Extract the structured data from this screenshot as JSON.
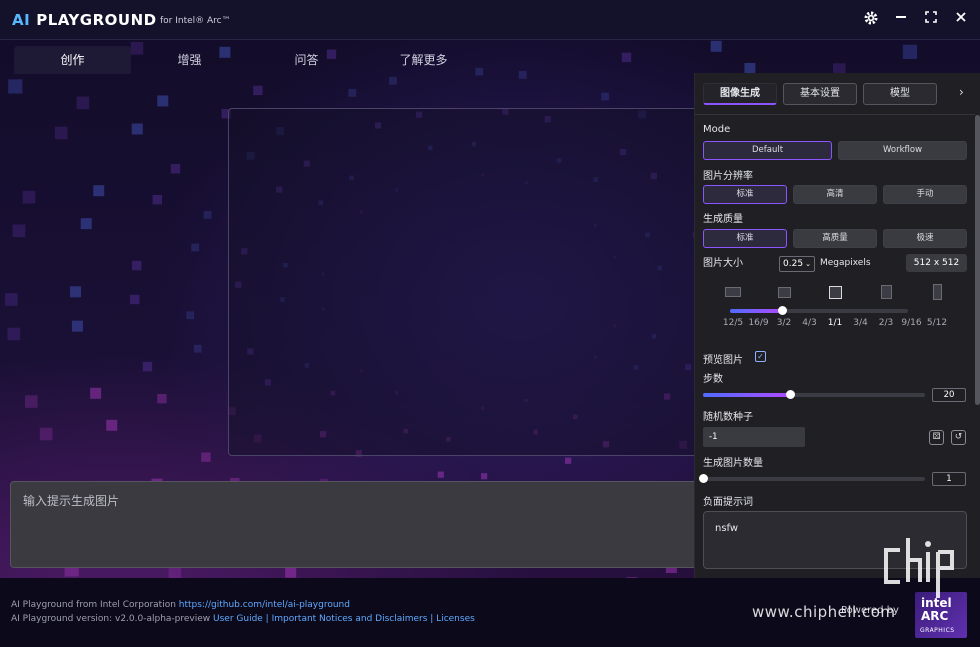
{
  "titlebar": {
    "brand_ai": "AI",
    "brand_name": "PLAYGROUND",
    "brand_sub": "for Intel® Arc™",
    "icons": [
      "gear-icon",
      "minimize-icon",
      "maximize-icon",
      "close-icon"
    ]
  },
  "main_tabs": [
    {
      "label": "创作",
      "active": true
    },
    {
      "label": "增强",
      "active": false
    },
    {
      "label": "问答",
      "active": false
    },
    {
      "label": "了解更多",
      "active": false
    }
  ],
  "prompt": {
    "placeholder": "输入提示生成图片"
  },
  "panel": {
    "tabs": [
      {
        "label": "图像生成",
        "active": true
      },
      {
        "label": "基本设置",
        "active": false
      },
      {
        "label": "模型",
        "active": false
      }
    ],
    "mode": {
      "label": "Mode",
      "options": [
        "Default",
        "Workflow"
      ],
      "selected": "Default"
    },
    "resolution": {
      "label": "图片分辨率",
      "options": [
        "标准",
        "高清",
        "手动"
      ],
      "selected": "标准"
    },
    "quality": {
      "label": "生成质量",
      "options": [
        "标准",
        "高质量",
        "极速"
      ],
      "selected": "标准"
    },
    "image_size": {
      "label": "图片大小",
      "megapixels_value": "0.25",
      "megapixels_label": "Megapixels",
      "dimensions": "512 x 512"
    },
    "ratios": {
      "labels": [
        "12/5",
        "16/9",
        "3/2",
        "4/3",
        "1/1",
        "3/4",
        "2/3",
        "9/16",
        "5/12"
      ],
      "selected_index": 4
    },
    "preview": {
      "label": "预览图片",
      "checked": true,
      "check_glyph": "✓"
    },
    "steps": {
      "label": "步数",
      "value": "20",
      "fraction": 0.39
    },
    "seed": {
      "label": "随机数种子",
      "value": "-1"
    },
    "image_count": {
      "label": "生成图片数量",
      "value": "1",
      "fraction": 0.0
    },
    "negative_prompt": {
      "label": "负面提示词",
      "value": "nsfw"
    },
    "chevron": "›"
  },
  "footer": {
    "line1_prefix": "AI Playground from Intel Corporation ",
    "line1_link": "https://github.com/intel/ai-playground",
    "line2_prefix": "AI Playground version: v2.0.0-alpha-preview ",
    "line2_links": "User Guide | Important Notices and Disclaimers | Licenses",
    "powered": "Powered by",
    "badge_line1": "intel",
    "badge_line2": "ARC",
    "badge_line3": "GRAPHICS"
  },
  "watermark": {
    "text": "www.chiphell.com"
  },
  "colors": {
    "accent": "#8a55ff",
    "link": "#5fa9ff",
    "brand_ai": "#58b7ff"
  }
}
